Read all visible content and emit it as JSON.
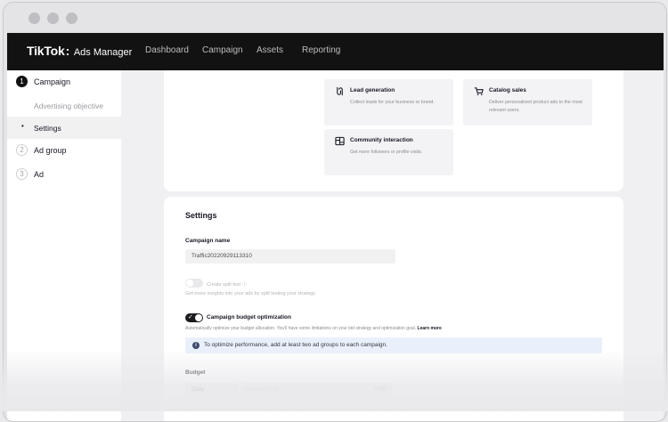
{
  "header": {
    "logo_brand": "TikTok",
    "logo_product": "Ads Manager",
    "nav": [
      "Dashboard",
      "Campaign",
      "Assets",
      "Reporting"
    ]
  },
  "sidebar": {
    "steps": [
      {
        "num": "1",
        "label": "Campaign"
      },
      {
        "num": "2",
        "label": "Ad group"
      },
      {
        "num": "3",
        "label": "Ad"
      }
    ],
    "sub_items": [
      {
        "label": "Advertising objective"
      },
      {
        "label": "Settings"
      }
    ],
    "bullet": "•"
  },
  "objectives": [
    {
      "title": "Lead generation",
      "desc": "Collect leads for your business or brand.",
      "icon": "lead-generation-icon"
    },
    {
      "title": "Catalog sales",
      "desc": "Deliver personalized product ads to the most relevant users.",
      "icon": "cart-icon"
    },
    {
      "title": "Community interaction",
      "desc": "Get more followers or profile visits.",
      "icon": "community-icon"
    }
  ],
  "settings": {
    "heading": "Settings",
    "campaign_name_label": "Campaign name",
    "campaign_name_value": "Traffic20220929113310",
    "split_test_label": "Create split test",
    "split_test_desc": "Get more insights into your ads by split testing your strategy.",
    "cbo_label": "Campaign budget optimization",
    "cbo_desc": "Automatically optimize your budget allocation. You'll have some limitations on your bid strategy and optimization goal.",
    "cbo_link": "Learn more",
    "banner_text": "To optimize performance, add at least two ad groups to each campaign.",
    "budget_label": "Budget",
    "budget_type": "Daily",
    "budget_placeholder": "At least 50.00",
    "currency": "USD"
  },
  "colors": {
    "topbar": "#121212",
    "banner_bg": "#eaf0fb",
    "accent_dark": "#1b1b1f"
  }
}
